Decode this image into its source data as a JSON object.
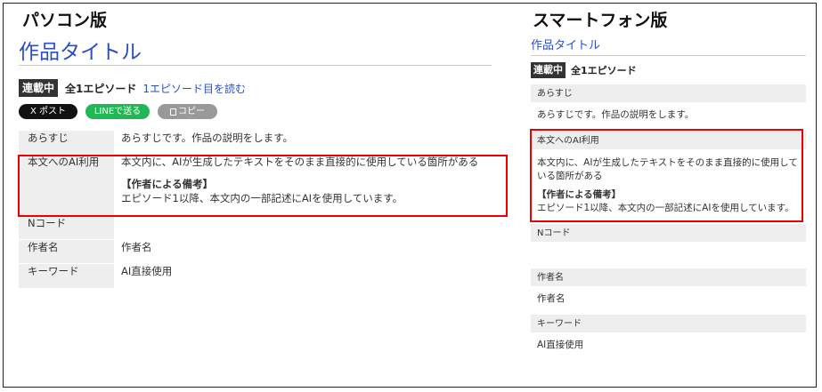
{
  "pc": {
    "heading": "パソコン版",
    "title": "作品タイトル",
    "badge": "連載中",
    "episodes": "全1エピソード",
    "read_link": "1エピソード目を読む",
    "share": {
      "x": "X ポスト",
      "line": "LINEで送る",
      "copy": "コピー"
    },
    "rows": {
      "synopsis_label": "あらすじ",
      "synopsis_value": "あらすじです。作品の説明をします。",
      "ai_label": "本文へのAI利用",
      "ai_value": "本文内に、AIが生成したテキストをそのまま直接的に使用している箇所がある",
      "note_title": "【作者による備考】",
      "note_value": "エピソード1以降、本文内の一部記述にAIを使用しています。",
      "ncode_label": "Nコード",
      "ncode_value": "",
      "author_label": "作者名",
      "author_value": "作者名",
      "keyword_label": "キーワード",
      "keyword_value": "AI直接使用"
    }
  },
  "sp": {
    "heading": "スマートフォン版",
    "title": "作品タイトル",
    "badge": "連載中",
    "episodes": "全1エピソード",
    "synopsis_label": "あらすじ",
    "synopsis_value": "あらすじです。作品の説明をします。",
    "ai_label": "本文へのAI利用",
    "ai_value": "本文内に、AIが生成したテキストをそのまま直接的に使用している箇所がある",
    "note_title": "【作者による備考】",
    "note_value": "エピソード1以降、本文内の一部記述にAIを使用しています。",
    "ncode_label": "Nコード",
    "author_label": "作者名",
    "author_value": "作者名",
    "keyword_label": "キーワード",
    "keyword_value": "AI直接使用"
  },
  "colors": {
    "link": "#2a4fc0",
    "highlight": "#e00000",
    "line_green": "#1fb855"
  }
}
